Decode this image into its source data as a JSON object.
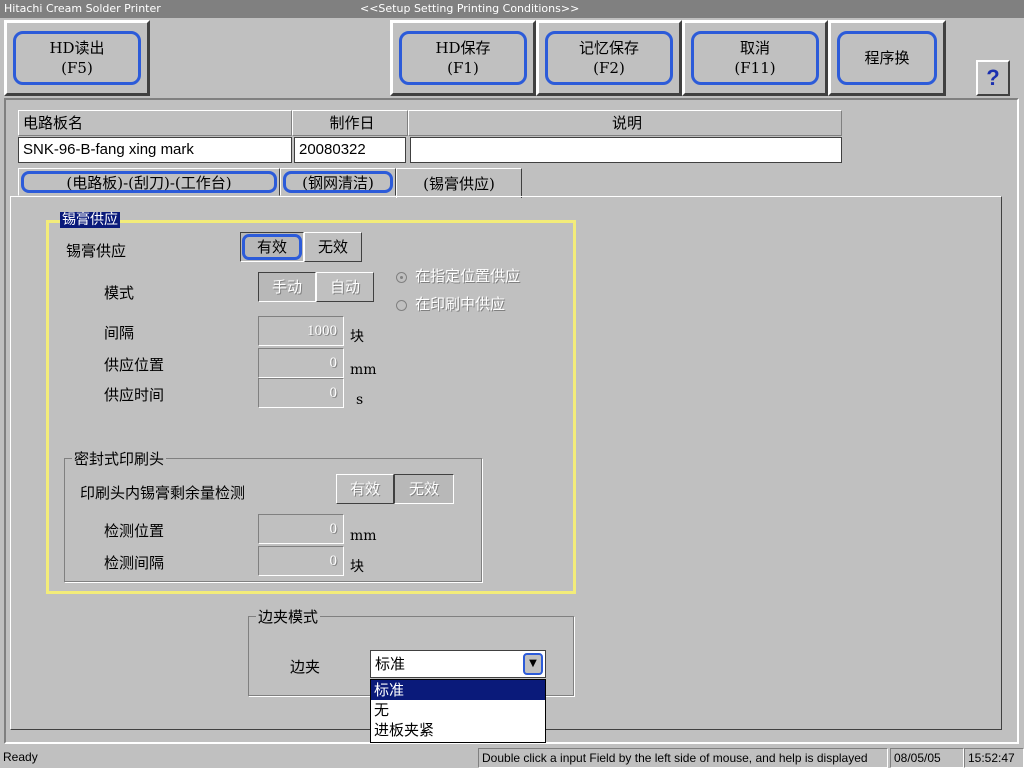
{
  "window": {
    "app_title": "Hitachi Cream Solder Printer",
    "screen_title": "<<Setup Setting Printing Conditions>>"
  },
  "toolbar": {
    "hd_read": [
      "HD读出",
      "(F5)"
    ],
    "hd_save": [
      "HD保存",
      "(F1)"
    ],
    "memory_save": [
      "记忆保存",
      "(F2)"
    ],
    "cancel": [
      "取消",
      "(F11)"
    ],
    "program_switch": "程序换",
    "help": "?"
  },
  "header": {
    "board_name_label": "电路板名",
    "date_label": "制作日",
    "desc_label": "说明",
    "board_name_value": "SNK-96-B-fang xing mark",
    "date_value": "20080322",
    "desc_value": ""
  },
  "tabs": [
    {
      "label": "(电路板)-(刮刀)-(工作台)"
    },
    {
      "label": "(钢网清洁)"
    },
    {
      "label": "(锡膏供应)"
    }
  ],
  "supply": {
    "group_title": "锡膏供应",
    "supply_label": "锡膏供应",
    "valid": "有效",
    "invalid": "无效",
    "mode_label": "模式",
    "manual": "手动",
    "auto": "自动",
    "radio_fixed": "在指定位置供应",
    "radio_printing": "在印刷中供应",
    "interval_label": "间隔",
    "interval_value": "1000",
    "interval_unit": "块",
    "position_label": "供应位置",
    "position_value": "0",
    "position_unit": "mm",
    "time_label": "供应时间",
    "time_value": "0",
    "time_unit": "s"
  },
  "sealed_head": {
    "title": "密封式印刷头",
    "remain_label": "印刷头内锡膏剩余量检测",
    "valid": "有效",
    "invalid": "无效",
    "det_pos_label": "检测位置",
    "det_pos_value": "0",
    "det_pos_unit": "mm",
    "det_int_label": "检测间隔",
    "det_int_value": "0",
    "det_int_unit": "块"
  },
  "clamp": {
    "title": "边夹模式",
    "label": "边夹",
    "selected": "标准",
    "options": [
      "标准",
      "无",
      "进板夹紧"
    ]
  },
  "status": {
    "ready": "Ready",
    "hint": "Double click a input Field by the left side of mouse, and help is displayed",
    "date": "08/05/05",
    "time": "15:52:47"
  },
  "colors": {
    "focus_ring": "#2c5bd9",
    "group_highlight": "#f3ec79",
    "selection": "#0a1a7a"
  }
}
